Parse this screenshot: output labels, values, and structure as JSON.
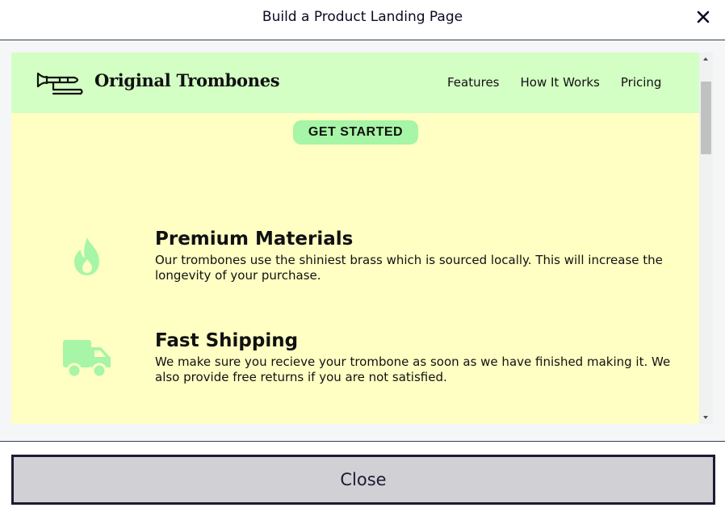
{
  "modal": {
    "title": "Build a Product Landing Page",
    "close_icon": "close-x-icon",
    "close_button_label": "Close"
  },
  "site": {
    "logo_icon": "trombone-icon",
    "brand": "Original Trombones",
    "nav": [
      {
        "label": "Features"
      },
      {
        "label": "How It Works"
      },
      {
        "label": "Pricing"
      }
    ],
    "cta_label": "GET STARTED",
    "features": [
      {
        "icon": "fire-icon",
        "title": "Premium Materials",
        "text": "Our trombones use the shiniest brass which is sourced locally. This will increase the longevity of your purchase."
      },
      {
        "icon": "truck-icon",
        "title": "Fast Shipping",
        "text": "We make sure you recieve your trombone as soon as we have finished making it. We also provide free returns if you are not satisfied."
      }
    ]
  },
  "colors": {
    "page_background": "#ffffc4",
    "header_background": "#d3ffc4",
    "accent_green": "#a7f5a7",
    "close_button_background": "#d0d0d5",
    "close_button_border": "#1b1b32"
  }
}
